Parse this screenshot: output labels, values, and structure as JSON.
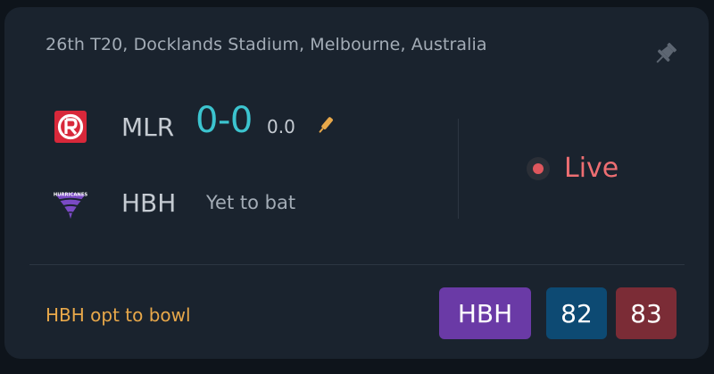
{
  "match": {
    "venue": "26th T20, Docklands Stadium, Melbourne, Australia",
    "pin_icon": "pin-icon",
    "status": "Live",
    "toss": "HBH opt to bowl"
  },
  "teams": [
    {
      "abbr": "MLR",
      "score": "0-0",
      "overs": "0.0",
      "logo_icon": "renegades-logo",
      "batting_icon": "cricket-bat-icon"
    },
    {
      "abbr": "HBH",
      "status": "Yet to bat",
      "logo_icon": "hurricanes-logo",
      "logo_text": "HURRICANES"
    }
  ],
  "chips": [
    {
      "label": "HBH",
      "color": "#6a3aa6"
    },
    {
      "label": "82",
      "color": "#0d4a73"
    },
    {
      "label": "83",
      "color": "#7b2c36"
    }
  ],
  "colors": {
    "background": "#0e141b",
    "card": "#1a232e",
    "score_accent": "#3cc4cf",
    "live": "#ee6e72",
    "toss": "#e8a84a"
  }
}
